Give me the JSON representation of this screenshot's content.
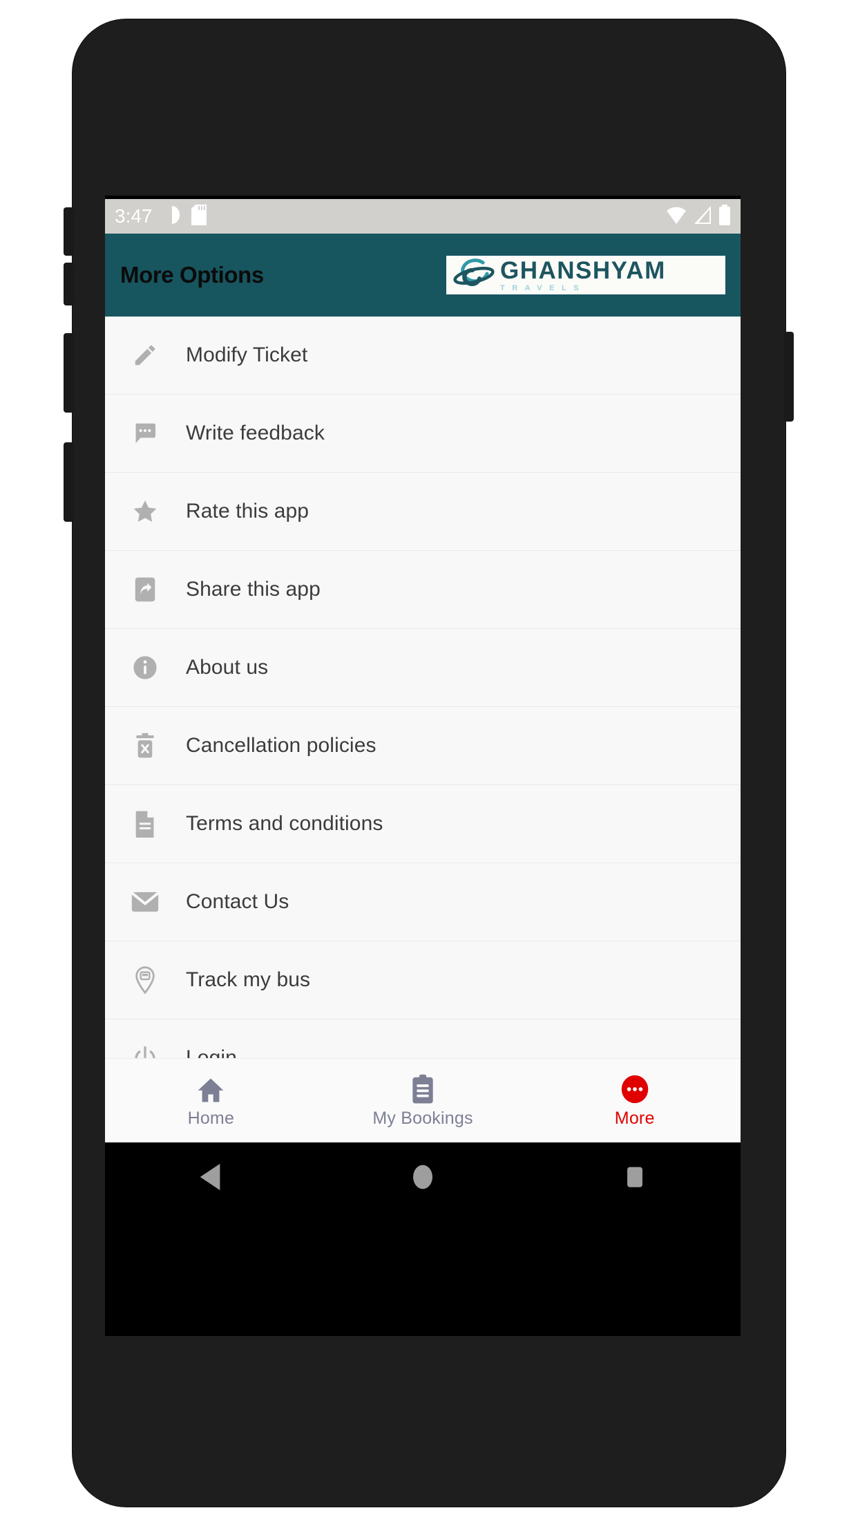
{
  "status_bar": {
    "time": "3:47",
    "left_icons": [
      "alarm-icon",
      "sd-card-icon"
    ],
    "right_icons": [
      "wifi-icon",
      "signal-icon",
      "battery-icon"
    ],
    "background": "#d2d0cd"
  },
  "app_bar": {
    "title": "More Options",
    "background": "#17555f",
    "title_color": "#0b0b0b",
    "logo": {
      "name": "GHANSHYAM",
      "tagline": "TRAVELS",
      "mark": "globe-swoosh-icon",
      "name_color": "#1d5560",
      "tagline_color": "#9fd2d8",
      "background": "#fbfbf8"
    }
  },
  "menu": {
    "items": [
      {
        "label": "Modify Ticket",
        "icon": "pencil-icon"
      },
      {
        "label": "Write feedback",
        "icon": "chat-bubble-icon"
      },
      {
        "label": "Rate this app",
        "icon": "star-icon"
      },
      {
        "label": "Share this app",
        "icon": "phone-share-icon"
      },
      {
        "label": "About us",
        "icon": "info-circle-icon"
      },
      {
        "label": "Cancellation policies",
        "icon": "trash-x-icon"
      },
      {
        "label": "Terms and conditions",
        "icon": "document-icon"
      },
      {
        "label": "Contact Us",
        "icon": "envelope-icon"
      },
      {
        "label": "Track my bus",
        "icon": "map-pin-bus-icon"
      },
      {
        "label": "Login",
        "icon": "power-icon"
      }
    ],
    "icon_color": "#b0b0b0",
    "label_color": "#3c3c3c",
    "background": "#f8f8f8"
  },
  "bottom_nav": {
    "tabs": [
      {
        "label": "Home",
        "icon": "home-icon",
        "active": false
      },
      {
        "label": "My Bookings",
        "icon": "clipboard-icon",
        "active": false
      },
      {
        "label": "More",
        "icon": "more-dots-icon",
        "active": true
      }
    ],
    "inactive_color": "#7d7f95",
    "active_color": "#e00000"
  },
  "android_nav": {
    "buttons": [
      "back-icon",
      "home-circle-icon",
      "recents-square-icon"
    ],
    "icon_color": "#9e9e9e",
    "background": "#000000"
  }
}
